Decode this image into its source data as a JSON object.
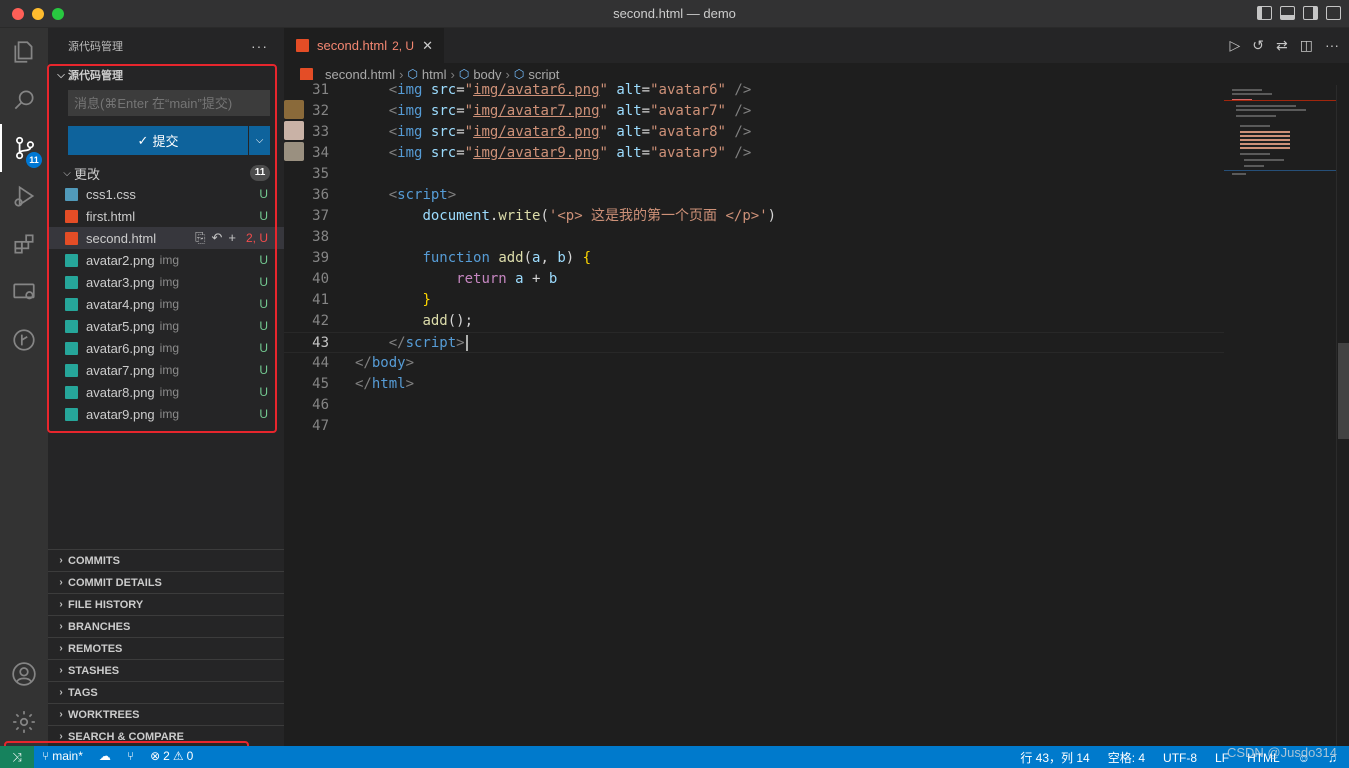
{
  "window": {
    "title": "second.html — demo"
  },
  "activity": {
    "scm_badge": "11"
  },
  "sidebar": {
    "header": "源代码管理",
    "more": "···",
    "section_title": "源代码管理",
    "commit_placeholder": "消息(⌘Enter 在“main”提交)",
    "commit_label": "提交",
    "changes_label": "更改",
    "changes_count": "11",
    "files": [
      {
        "name": "css1.css",
        "desc": "",
        "status": "U",
        "icon": "css-file-icon"
      },
      {
        "name": "first.html",
        "desc": "",
        "status": "U",
        "icon": "html-file-icon"
      },
      {
        "name": "second.html",
        "desc": "",
        "status": "2, U",
        "icon": "html-file-icon"
      },
      {
        "name": "avatar2.png",
        "desc": "img",
        "status": "U",
        "icon": "image-file-icon"
      },
      {
        "name": "avatar3.png",
        "desc": "img",
        "status": "U",
        "icon": "image-file-icon"
      },
      {
        "name": "avatar4.png",
        "desc": "img",
        "status": "U",
        "icon": "image-file-icon"
      },
      {
        "name": "avatar5.png",
        "desc": "img",
        "status": "U",
        "icon": "image-file-icon"
      },
      {
        "name": "avatar6.png",
        "desc": "img",
        "status": "U",
        "icon": "image-file-icon"
      },
      {
        "name": "avatar7.png",
        "desc": "img",
        "status": "U",
        "icon": "image-file-icon"
      },
      {
        "name": "avatar8.png",
        "desc": "img",
        "status": "U",
        "icon": "image-file-icon"
      },
      {
        "name": "avatar9.png",
        "desc": "img",
        "status": "U",
        "icon": "image-file-icon"
      }
    ],
    "panels": [
      "COMMITS",
      "COMMIT DETAILS",
      "FILE HISTORY",
      "BRANCHES",
      "REMOTES",
      "STASHES",
      "TAGS",
      "WORKTREES",
      "SEARCH & COMPARE"
    ]
  },
  "editor": {
    "tab_label": "second.html",
    "tab_status": "2, U",
    "breadcrumb": [
      "second.html",
      "html",
      "body",
      "script"
    ],
    "current_line": "43"
  },
  "status": {
    "branch": "main*",
    "errors": "2",
    "warnings": "0",
    "position": "行 43，列 14",
    "spaces": "空格: 4",
    "encoding": "UTF-8",
    "eol": "LF",
    "language": "HTML"
  },
  "watermark": "CSDN @Jusdo314",
  "colors": {
    "accent": "#007acc",
    "commit_button": "#0e639c",
    "highlight_box": "#e8262d",
    "untracked": "#73c991",
    "modified": "#f14c4c"
  }
}
